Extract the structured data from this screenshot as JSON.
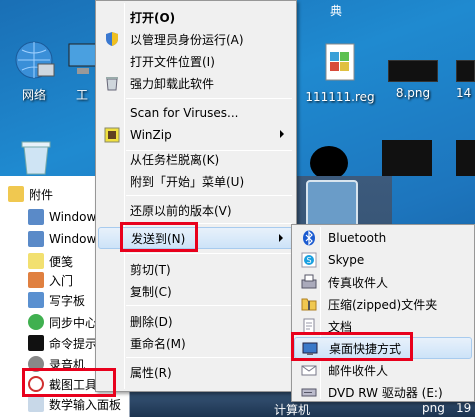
{
  "desktop": {
    "top_char": "典",
    "icons": [
      {
        "label": "网络",
        "icon": "network-globe-icon"
      },
      {
        "label": "工",
        "icon": "computer-icon"
      },
      {
        "label": "111111.reg",
        "icon": "registry-file-icon"
      },
      {
        "label": "8.png",
        "icon": "image-file-icon"
      },
      {
        "label": "14",
        "icon": "image-file-icon"
      }
    ],
    "bottom_labels": {
      "computer": "计算机",
      "png": "png",
      "num": "19"
    }
  },
  "start_menu": {
    "folder_label": "附件",
    "items": [
      {
        "label": "Window",
        "icon": "window-icon"
      },
      {
        "label": "Window",
        "icon": "window-icon"
      },
      {
        "label": "便笺",
        "icon": "sticky-note-icon"
      },
      {
        "label": "入门",
        "icon": "getting-started-icon"
      },
      {
        "label": "写字板",
        "icon": "wordpad-icon"
      },
      {
        "label": "同步中心",
        "icon": "sync-center-icon"
      },
      {
        "label": "命令提示",
        "icon": "cmd-icon"
      },
      {
        "label": "录音机",
        "icon": "recorder-icon"
      },
      {
        "label": "截图工具",
        "icon": "snipping-tool-icon"
      },
      {
        "label": "数学输入面板",
        "icon": "math-input-icon"
      }
    ]
  },
  "context_menu": {
    "items": [
      {
        "label": "打开(O)",
        "bold": true,
        "icon": ""
      },
      {
        "label": "以管理员身份运行(A)",
        "icon": "shield-icon"
      },
      {
        "label": "打开文件位置(I)",
        "icon": ""
      },
      {
        "label": "强力卸载此软件",
        "icon": "trash-icon"
      },
      {
        "label": "Scan for Viruses...",
        "icon": ""
      },
      {
        "label": "WinZip",
        "icon": "winzip-icon",
        "submenu": true
      },
      {
        "label": "从任务栏脱离(K)",
        "icon": ""
      },
      {
        "label": "附到「开始」菜单(U)",
        "icon": ""
      },
      {
        "label": "还原以前的版本(V)",
        "icon": ""
      },
      {
        "label": "发送到(N)",
        "icon": "",
        "submenu": true,
        "highlighted": true
      },
      {
        "label": "剪切(T)",
        "icon": ""
      },
      {
        "label": "复制(C)",
        "icon": ""
      },
      {
        "label": "删除(D)",
        "icon": ""
      },
      {
        "label": "重命名(M)",
        "icon": ""
      },
      {
        "label": "属性(R)",
        "icon": ""
      }
    ]
  },
  "send_to_menu": {
    "items": [
      {
        "label": "Bluetooth",
        "icon": "bluetooth-icon"
      },
      {
        "label": "Skype",
        "icon": "skype-icon"
      },
      {
        "label": "传真收件人",
        "icon": "fax-icon"
      },
      {
        "label": "压缩(zipped)文件夹",
        "icon": "zip-folder-icon"
      },
      {
        "label": "文档",
        "icon": "documents-icon"
      },
      {
        "label": "桌面快捷方式",
        "icon": "desktop-shortcut-icon",
        "highlighted": true
      },
      {
        "label": "邮件收件人",
        "icon": "mail-icon"
      },
      {
        "label": "DVD RW 驱动器 (E:)",
        "icon": "dvd-drive-icon"
      }
    ]
  },
  "colors": {
    "highlight_border": "#e8001c",
    "menu_bg": "#f0f0f0"
  }
}
